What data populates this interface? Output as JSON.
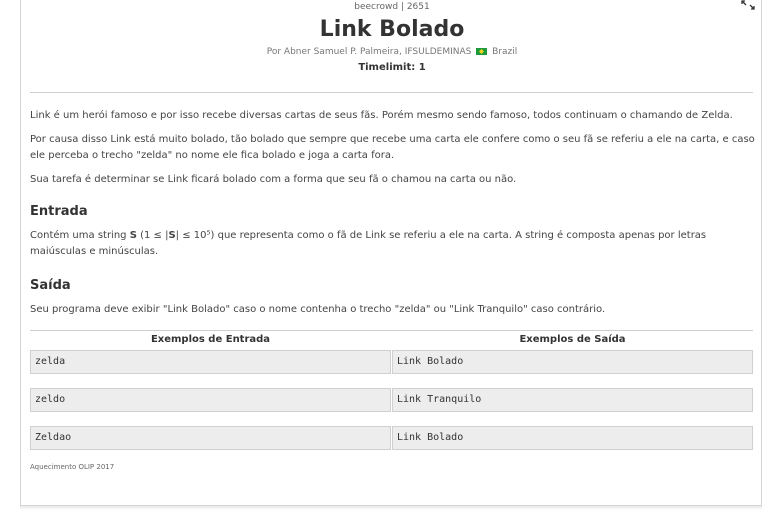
{
  "problem": {
    "source": "beecrowd | 2651",
    "title": "Link Bolado",
    "author_prefix": "Por Abner Samuel P. Palmeira, IFSULDEMINAS",
    "country": "Brazil",
    "timelimit": "Timelimit: 1"
  },
  "description": {
    "p1": "Link é um herói famoso e por isso recebe diversas cartas de seus fãs. Porém mesmo sendo famoso, todos continuam o chamando de Zelda.",
    "p2": "Por causa disso Link está muito bolado, tão bolado que sempre que recebe uma carta ele confere como o seu fã se referiu a ele na carta, e caso ele perceba o trecho \"zelda\" no nome ele fica bolado e joga a carta fora.",
    "p3": "Sua tarefa é determinar se Link ficará bolado com a forma que seu fã o chamou na carta ou não."
  },
  "input": {
    "heading": "Entrada",
    "text_before": "Contém uma string ",
    "var": "S",
    "text_constraint": " (1 ≤ |",
    "var2": "S",
    "text_after": "| ≤ 10⁵) que representa como o fã de Link se referiu a ele na carta. A string é composta apenas por letras maiúsculas e minúsculas."
  },
  "output": {
    "heading": "Saída",
    "text": "Seu programa deve exibir \"Link Bolado\" caso o nome contenha o trecho \"zelda\" ou \"Link Tranquilo\" caso contrário."
  },
  "examples": {
    "input_header": "Exemplos de Entrada",
    "output_header": "Exemplos de Saída",
    "rows": [
      {
        "input": "zelda",
        "output": "Link Bolado"
      },
      {
        "input": "zeldo",
        "output": "Link Tranquilo"
      },
      {
        "input": "Zeldao",
        "output": "Link Bolado"
      }
    ]
  },
  "footnote": "Aquecimento OLIP 2017"
}
